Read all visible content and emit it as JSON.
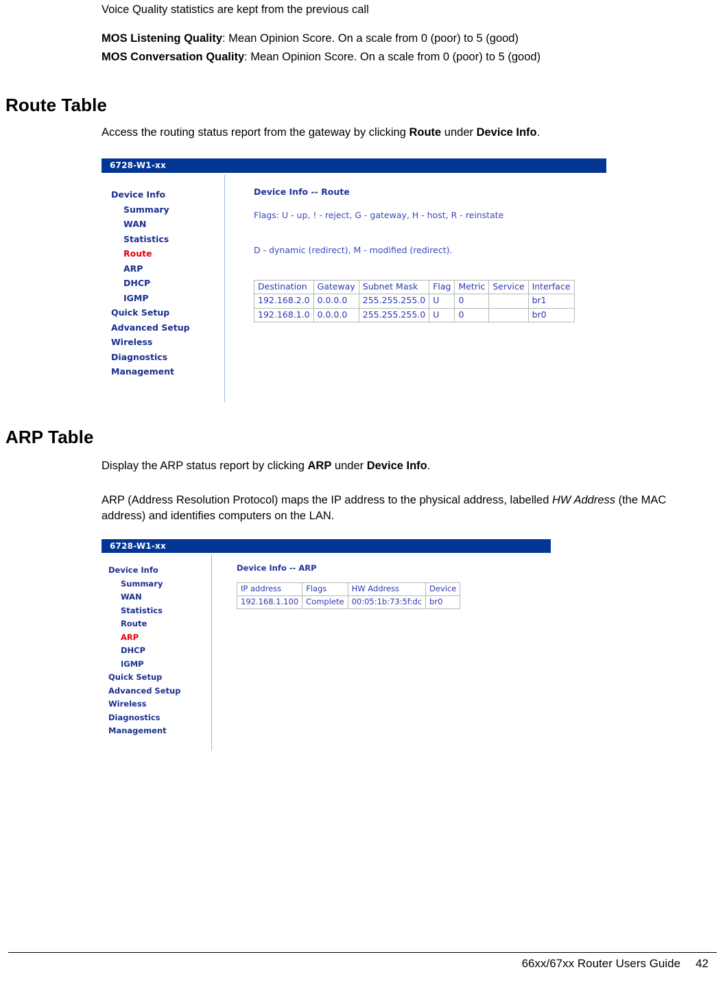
{
  "document": {
    "intro_line": "Voice Quality statistics are kept from the previous call",
    "mos_listening_label": "MOS Listening Quality",
    "mos_listening_text": ": Mean Opinion Score. On a scale from 0 (poor) to 5 (good)",
    "mos_conversation_label": "MOS Conversation Quality",
    "mos_conversation_text": ": Mean Opinion Score. On a scale from 0 (poor) to 5 (good)"
  },
  "route_section": {
    "heading": "Route Table",
    "intro_prefix": "Access the routing status report from the gateway by clicking ",
    "intro_bold1": "Route",
    "intro_mid": " under ",
    "intro_bold2": "Device Info",
    "intro_suffix": "."
  },
  "arp_section": {
    "heading": "ARP Table",
    "intro_prefix": "Display the ARP status report by clicking ",
    "intro_bold1": "ARP",
    "intro_mid": " under ",
    "intro_bold2": "Device Info",
    "intro_suffix": ".",
    "desc_prefix": "ARP (Address Resolution Protocol) maps the IP address to the physical address, labelled ",
    "desc_italic": "HW Address",
    "desc_suffix": " (the MAC address) and identifies computers on the LAN."
  },
  "route_screenshot": {
    "titlebar": "6728-W1-xx",
    "nav": [
      {
        "label": "Device Info",
        "level": 1,
        "active": false
      },
      {
        "label": "Summary",
        "level": 2,
        "active": false
      },
      {
        "label": "WAN",
        "level": 2,
        "active": false
      },
      {
        "label": "Statistics",
        "level": 2,
        "active": false
      },
      {
        "label": "Route",
        "level": 2,
        "active": true
      },
      {
        "label": "ARP",
        "level": 2,
        "active": false
      },
      {
        "label": "DHCP",
        "level": 2,
        "active": false
      },
      {
        "label": "IGMP",
        "level": 2,
        "active": false
      },
      {
        "label": "Quick Setup",
        "level": 1,
        "active": false
      },
      {
        "label": "Advanced Setup",
        "level": 1,
        "active": false
      },
      {
        "label": "Wireless",
        "level": 1,
        "active": false
      },
      {
        "label": "Diagnostics",
        "level": 1,
        "active": false
      },
      {
        "label": "Management",
        "level": 1,
        "active": false
      }
    ],
    "panel_title": "Device Info -- Route",
    "flags_line1": "Flags: U - up, ! - reject, G - gateway, H - host, R - reinstate",
    "flags_line2": "D - dynamic (redirect), M - modified (redirect).",
    "table": {
      "headers": [
        "Destination",
        "Gateway",
        "Subnet Mask",
        "Flag",
        "Metric",
        "Service",
        "Interface"
      ],
      "rows": [
        [
          "192.168.2.0",
          "0.0.0.0",
          "255.255.255.0",
          "U",
          "0",
          "",
          "br1"
        ],
        [
          "192.168.1.0",
          "0.0.0.0",
          "255.255.255.0",
          "U",
          "0",
          "",
          "br0"
        ]
      ]
    }
  },
  "arp_screenshot": {
    "titlebar": "6728-W1-xx",
    "nav": [
      {
        "label": "Device Info",
        "level": 1,
        "active": false
      },
      {
        "label": "Summary",
        "level": 2,
        "active": false
      },
      {
        "label": "WAN",
        "level": 2,
        "active": false
      },
      {
        "label": "Statistics",
        "level": 2,
        "active": false
      },
      {
        "label": "Route",
        "level": 2,
        "active": false
      },
      {
        "label": "ARP",
        "level": 2,
        "active": true
      },
      {
        "label": "DHCP",
        "level": 2,
        "active": false
      },
      {
        "label": "IGMP",
        "level": 2,
        "active": false
      },
      {
        "label": "Quick Setup",
        "level": 1,
        "active": false
      },
      {
        "label": "Advanced Setup",
        "level": 1,
        "active": false
      },
      {
        "label": "Wireless",
        "level": 1,
        "active": false
      },
      {
        "label": "Diagnostics",
        "level": 1,
        "active": false
      },
      {
        "label": "Management",
        "level": 1,
        "active": false
      }
    ],
    "panel_title": "Device Info -- ARP",
    "table": {
      "headers": [
        "IP address",
        "Flags",
        "HW Address",
        "Device"
      ],
      "rows": [
        [
          "192.168.1.100",
          "Complete",
          "00:05:1b:73:5f:dc",
          "br0"
        ]
      ]
    }
  },
  "footer": {
    "guide": "66xx/67xx Router Users Guide",
    "page": "42"
  },
  "colors": {
    "titlebar_blue": "#033594",
    "nav_blue": "#1a2f8f",
    "nav_active_red": "#e3000b",
    "table_text_blue": "#2b38ad",
    "divider_blue": "#9db4e8"
  }
}
